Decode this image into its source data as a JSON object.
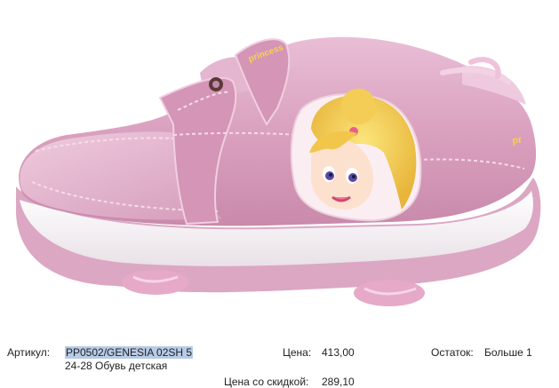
{
  "product": {
    "article_label": "Артикул:",
    "article_value": "PP0502/GENESIA 02SH 5",
    "subtitle": "24-28 Обувь детская",
    "price_label": "Цена:",
    "price_value": "413,00",
    "discount_label": "Цена со скидкой:",
    "discount_value": "289,10",
    "stock_label": "Остаток:",
    "stock_value": "Больше 1"
  },
  "colors": {
    "shoe_pink": "#e6b3cc",
    "sole_white": "#f3eef2",
    "highlight": "#b7cbe6"
  }
}
